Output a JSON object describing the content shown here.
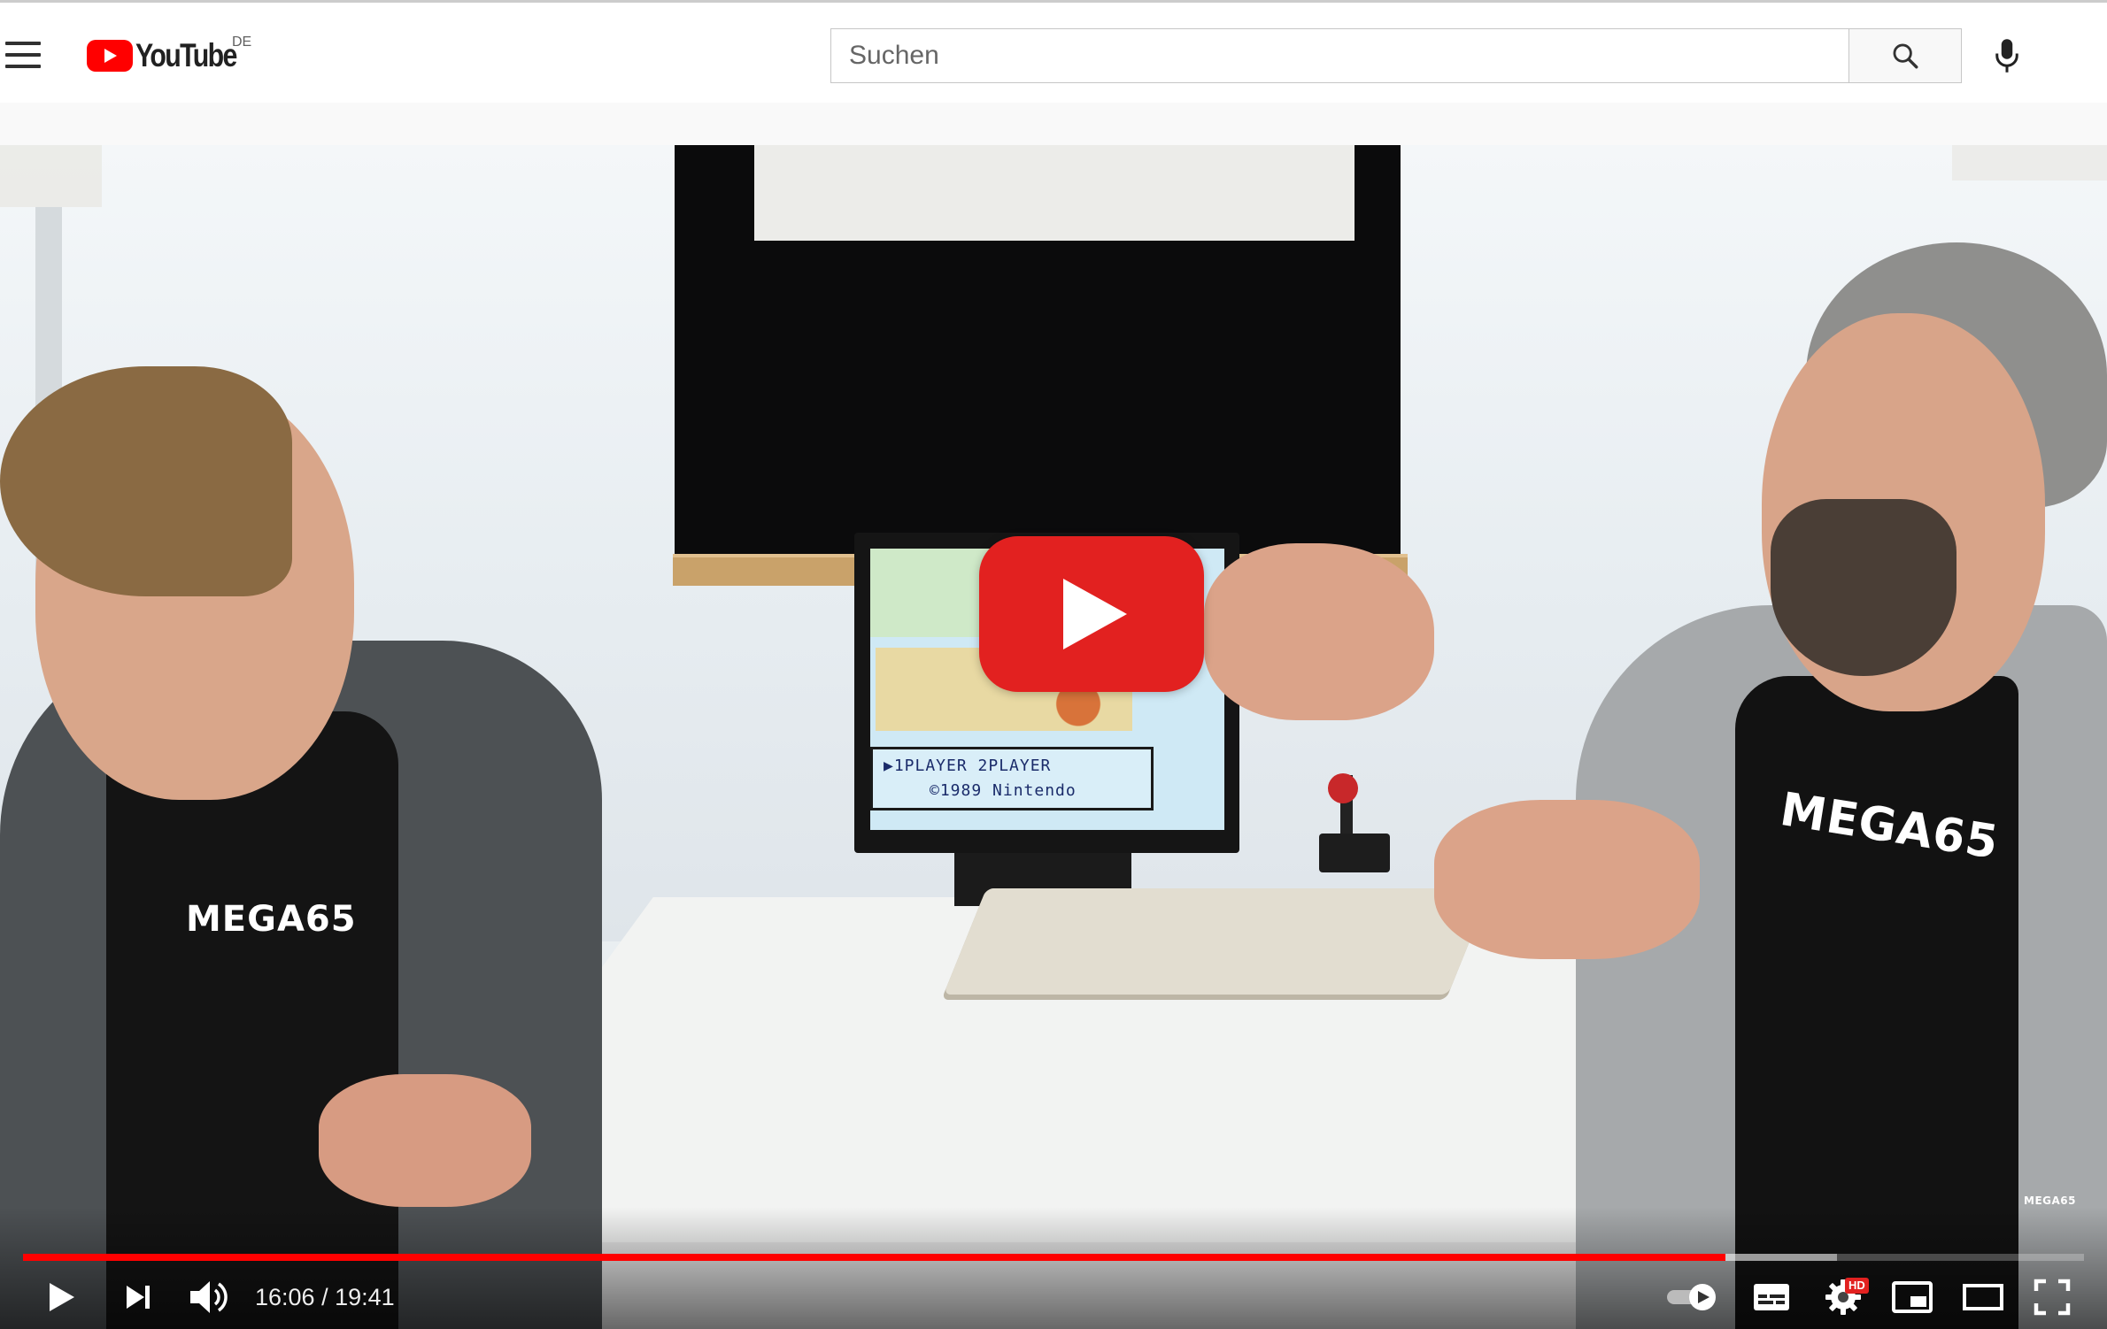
{
  "masthead": {
    "logo_text": "YouTube",
    "country_code": "DE",
    "search_placeholder": "Suchen",
    "icons": [
      "menu-icon",
      "youtube-logo-icon",
      "search-icon",
      "microphone-icon"
    ]
  },
  "player": {
    "video_content": {
      "game_line_1": "▶1PLAYER   2PLAYER",
      "game_line_2": "©1989 Nintendo",
      "shirt_logo_left": "MEGA65",
      "shirt_logo_right": "MEGA65",
      "watermark": "MEGA65"
    },
    "current_time": "16:06",
    "duration": "19:41",
    "time_display": "16:06 / 19:41",
    "progress_fraction": 0.8262,
    "buffered_fraction": 0.88,
    "hd_badge": "HD",
    "autoplay_on": true,
    "colors": {
      "brand_red": "#ff0000",
      "progress_played": "#ff0000",
      "play_button_red": "#e22120"
    },
    "control_icons": [
      "play-icon",
      "next-icon",
      "volume-icon",
      "autoplay-toggle-icon",
      "subtitles-icon",
      "settings-icon",
      "miniplayer-icon",
      "theater-mode-icon",
      "fullscreen-icon"
    ]
  }
}
